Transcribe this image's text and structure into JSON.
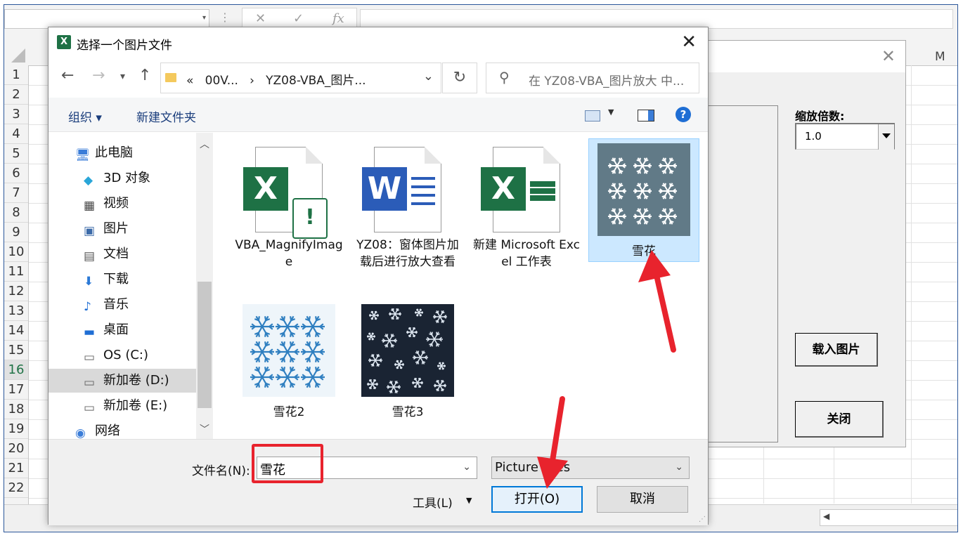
{
  "excel": {
    "fx_label": "fx",
    "cancel_glyph": "✕",
    "enter_glyph": "✓",
    "column_m": "M",
    "rows": [
      "1",
      "2",
      "3",
      "4",
      "5",
      "6",
      "7",
      "8",
      "9",
      "10",
      "11",
      "12",
      "13",
      "14",
      "15",
      "16",
      "17",
      "18",
      "19",
      "20",
      "21",
      "22"
    ],
    "active_row": "16"
  },
  "userform": {
    "zoom_label": "缩放倍数:",
    "zoom_value": "1.0",
    "load_button": "载入图片",
    "close_button": "关闭"
  },
  "dialog": {
    "title": "选择一个图片文件",
    "breadcrumb_prefix": "«",
    "breadcrumb_1": "00V...",
    "breadcrumb_sep": "›",
    "breadcrumb_2": "YZ08-VBA_图片...",
    "search_placeholder": "在 YZ08-VBA_图片放大 中...",
    "toolbar": {
      "organize": "组织 ▾",
      "new_folder": "新建文件夹",
      "help": "?"
    },
    "sidebar": [
      {
        "label": "此电脑",
        "icon": "computer-icon"
      },
      {
        "label": "3D 对象",
        "icon": "cube-icon"
      },
      {
        "label": "视频",
        "icon": "film-icon"
      },
      {
        "label": "图片",
        "icon": "picture-icon"
      },
      {
        "label": "文档",
        "icon": "document-icon"
      },
      {
        "label": "下载",
        "icon": "download-icon"
      },
      {
        "label": "音乐",
        "icon": "music-icon"
      },
      {
        "label": "桌面",
        "icon": "desktop-icon"
      },
      {
        "label": "OS (C:)",
        "icon": "drive-icon"
      },
      {
        "label": "新加卷 (D:)",
        "icon": "drive-icon"
      },
      {
        "label": "新加卷 (E:)",
        "icon": "drive-icon"
      },
      {
        "label": "网络",
        "icon": "network-icon"
      }
    ],
    "files": [
      {
        "name": "VBA_MagnifyImage",
        "type": "excel-macro"
      },
      {
        "name": "YZ08：窗体图片加载后进行放大查看",
        "type": "word"
      },
      {
        "name": "新建 Microsoft Excel 工作表",
        "type": "excel"
      },
      {
        "name": "雪花",
        "type": "image"
      },
      {
        "name": "雪花2",
        "type": "image"
      },
      {
        "name": "雪花3",
        "type": "image"
      }
    ],
    "filename_label": "文件名(N):",
    "filename_value": "雪花",
    "filter_value": "Picture Files",
    "tools_label": "工具(L)",
    "open_button": "打开(O)",
    "cancel_button": "取消"
  },
  "colors": {
    "accent": "#0078d7",
    "annotation": "#e8232d",
    "excel_green": "#1e7145",
    "word_blue": "#2b5cb8",
    "selected_bg": "#cce8ff"
  }
}
